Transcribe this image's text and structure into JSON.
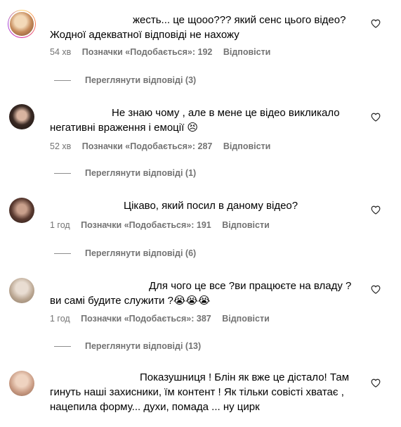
{
  "comments": [
    {
      "text": "жесть... це щооо??? який сенс цього відео? Жодної адекватної відповіді не нахожу",
      "time": "54 хв",
      "likes": "Позначки «Подобається»: 192",
      "reply": "Відповісти",
      "view_replies": "Переглянути відповіді (3)"
    },
    {
      "text": "Не знаю чому , але в мене це відео викликало негативні враження і емоції 😣",
      "time": "52 хв",
      "likes": "Позначки «Подобається»: 287",
      "reply": "Відповісти",
      "view_replies": "Переглянути відповіді (1)"
    },
    {
      "text": "Цікаво, який посил в даному відео?",
      "time": "1 год",
      "likes": "Позначки «Подобається»: 191",
      "reply": "Відповісти",
      "view_replies": "Переглянути відповіді (6)"
    },
    {
      "text": "Для чого це все ?ви працюєте на владу ? ви самі будите служити ?😭😭😭",
      "time": "1 год",
      "likes": "Позначки «Подобається»: 387",
      "reply": "Відповісти",
      "view_replies": "Переглянути відповіді (13)"
    },
    {
      "text": "Показушниця ! Блін як вже це дістало! Там гинуть наші захисники, їм контент ! Як тільки совісті хватає , нацепила форму... духи, помада ... ну цирк"
    }
  ],
  "icons": {
    "like": "heart-icon"
  },
  "colors": {
    "text": "#000000",
    "meta": "#737373",
    "story_ring": "#d6249f"
  }
}
